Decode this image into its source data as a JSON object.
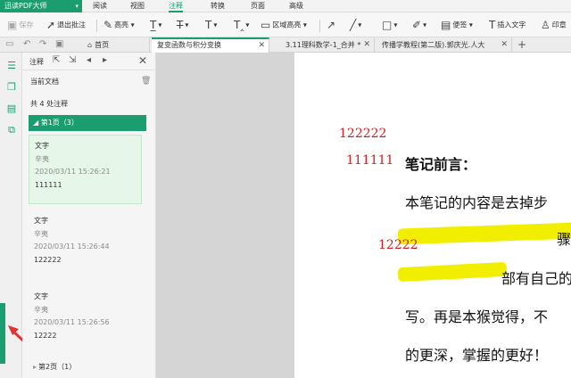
{
  "app": {
    "name": "迅读PDF大师"
  },
  "menus": [
    "阅读",
    "视图",
    "注释",
    "转换",
    "页面",
    "高级"
  ],
  "active_menu": "注释",
  "toolbar": {
    "save": "保存",
    "exit_annot": "退出批注",
    "highlight": "高亮",
    "area_highlight": "区域高亮",
    "note": "便签",
    "insert_text": "插入文字",
    "stamp": "印章"
  },
  "tabs": {
    "home": "首页",
    "items": [
      "复变函数与积分变换",
      "3.11理科数学-1_合并 *",
      "传播学教程(第二版).郭庆光.人大"
    ]
  },
  "panel": {
    "title": "注释",
    "current_doc": "当前文档",
    "total": "共 4 处注释",
    "page1": "第1页（3）",
    "page2": "第2页（1）",
    "cards": [
      {
        "type": "文字",
        "author": "辛夷",
        "time": "2020/03/11 15:26:21",
        "content": "111111"
      },
      {
        "type": "文字",
        "author": "辛夷",
        "time": "2020/03/11 15:26:44",
        "content": "122222"
      },
      {
        "type": "文字",
        "author": "辛夷",
        "time": "2020/03/11 15:26:56",
        "content": "12222"
      }
    ]
  },
  "document": {
    "annot1": "122222",
    "annot2": "111111",
    "annot3": "12222",
    "heading": "笔记前言：",
    "line1": "本笔记的内容是去掉步",
    "line2_tail": "骤",
    "line3": "部有自己的",
    "line4": "写。再是本猴觉得，不",
    "line5": "的更深，掌握的更好！"
  },
  "colors": {
    "accent": "#1a9e6f",
    "highlight": "#f2ee00",
    "annot_text": "#d02020"
  }
}
